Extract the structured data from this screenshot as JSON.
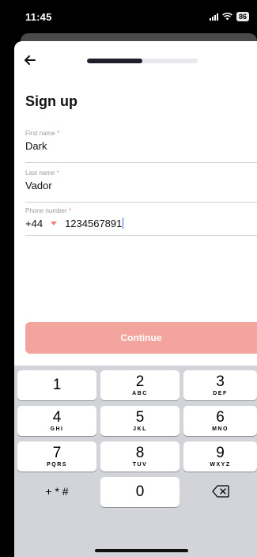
{
  "status_bar": {
    "time": "11:45",
    "battery": "86"
  },
  "header": {
    "progress_percent": 50
  },
  "form": {
    "title": "Sign up",
    "required_marker": "*",
    "first_name": {
      "label": "First name",
      "value": "Dark"
    },
    "last_name": {
      "label": "Last name",
      "value": "Vador"
    },
    "phone": {
      "label": "Phone number",
      "country_code": "+44",
      "value": "1234567891"
    }
  },
  "continue_label": "Continue",
  "keypad": {
    "keys": [
      {
        "digit": "1",
        "letters": ""
      },
      {
        "digit": "2",
        "letters": "ABC"
      },
      {
        "digit": "3",
        "letters": "DEF"
      },
      {
        "digit": "4",
        "letters": "GHI"
      },
      {
        "digit": "5",
        "letters": "JKL"
      },
      {
        "digit": "6",
        "letters": "MNO"
      },
      {
        "digit": "7",
        "letters": "PQRS"
      },
      {
        "digit": "8",
        "letters": "TUV"
      },
      {
        "digit": "9",
        "letters": "WXYZ"
      },
      {
        "digit": "0",
        "letters": ""
      }
    ],
    "symbols_label": "+ * #"
  },
  "colors": {
    "accent": "#ec8078",
    "button_disabled": "#f3a59d",
    "progress": "#1f1f2e"
  }
}
